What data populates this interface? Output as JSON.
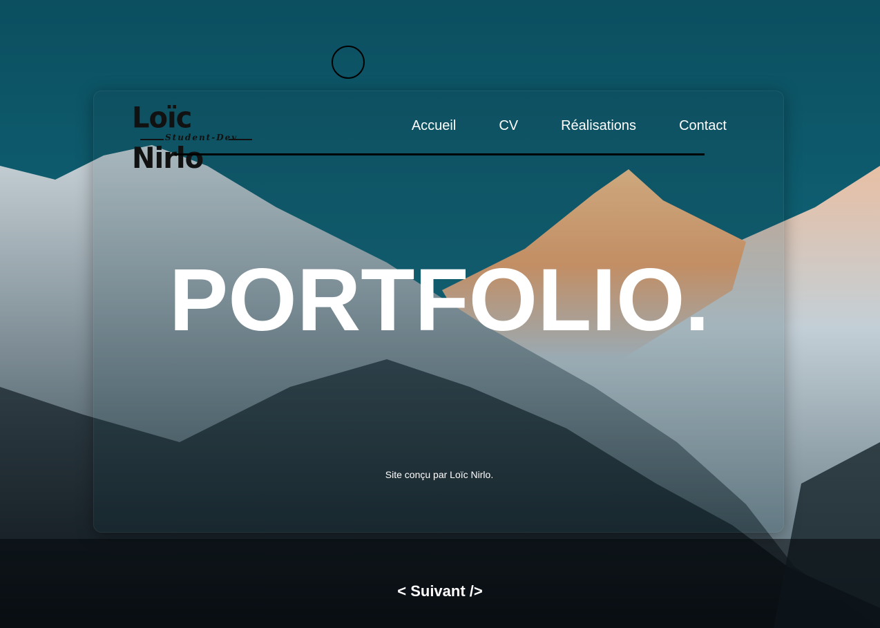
{
  "logo": {
    "name": "Loïc Nirlo",
    "tagline": "Student-Dev"
  },
  "nav": {
    "items": [
      {
        "label": "Accueil"
      },
      {
        "label": "CV"
      },
      {
        "label": "Réalisations"
      },
      {
        "label": "Contact"
      }
    ]
  },
  "hero": {
    "title": "PORTFOLIO."
  },
  "footer": {
    "credit": "Site conçu par Loïc Nirlo."
  },
  "pager": {
    "next_label": "< Suivant />"
  },
  "colors": {
    "sky": "#0d5a6b",
    "peak_glow": "#f0a868",
    "text": "#ffffff",
    "logo_ink": "#111111"
  }
}
